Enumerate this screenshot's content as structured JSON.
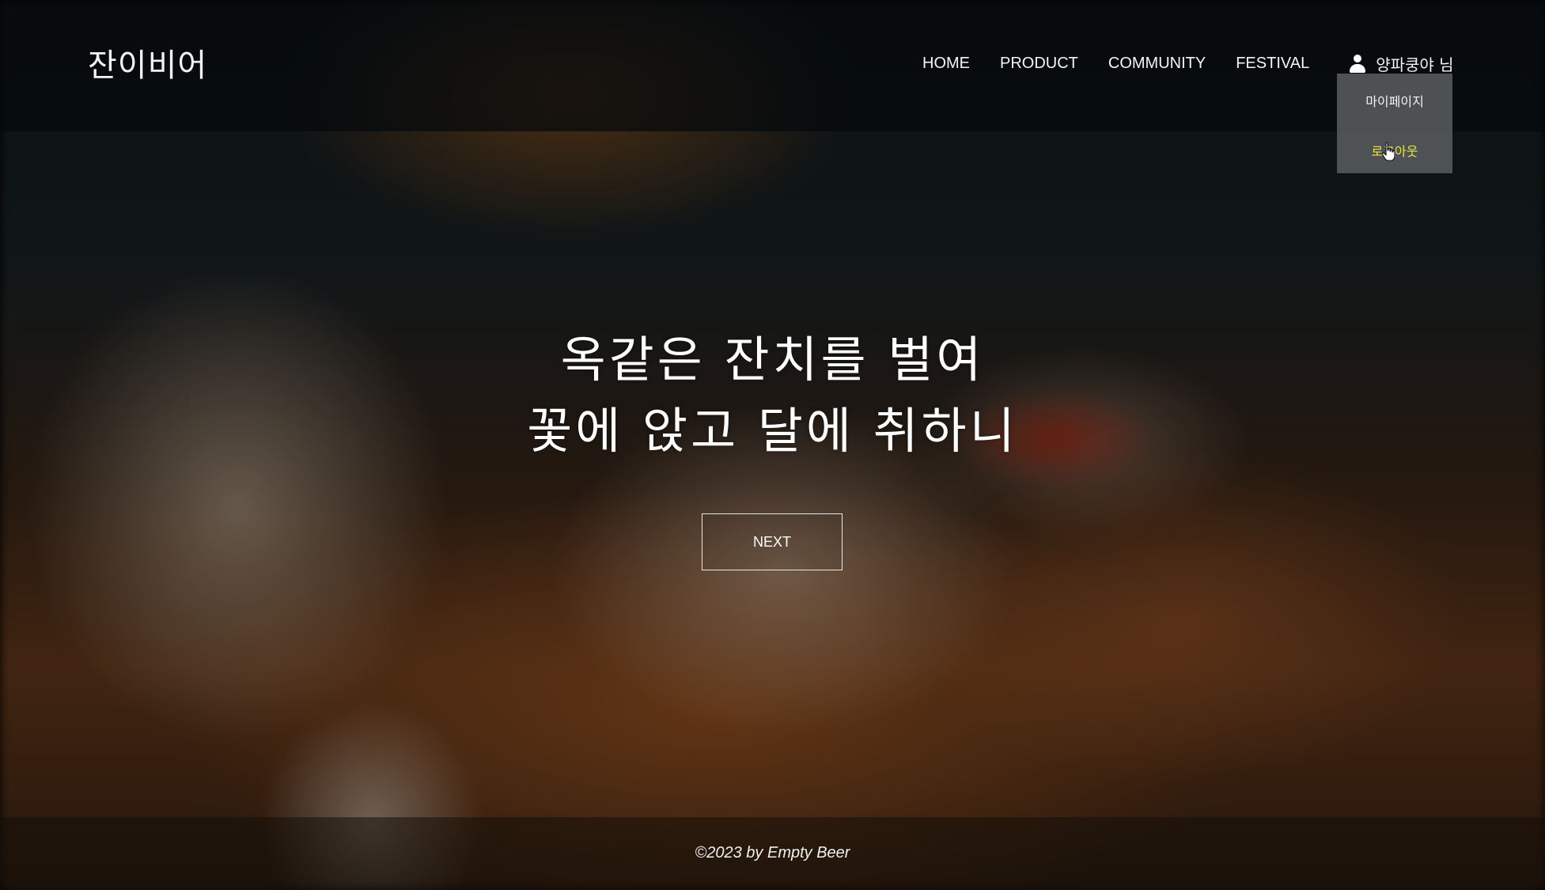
{
  "header": {
    "logo": "잔이비어",
    "nav": {
      "home": "HOME",
      "product": "PRODUCT",
      "community": "COMMUNITY",
      "festival": "FESTIVAL"
    },
    "user_name": "양파쿵야 님",
    "user_icon": "user-icon"
  },
  "user_menu": {
    "mypage": "마이페이지",
    "logout": "로그아웃",
    "logout_hover_color": "#e8e34a"
  },
  "hero": {
    "line1": "옥같은 잔치를 벌여",
    "line2": "꽃에 앉고 달에 취하니",
    "next_label": "NEXT"
  },
  "footer": {
    "copyright": "©2023 by Empty Beer"
  }
}
